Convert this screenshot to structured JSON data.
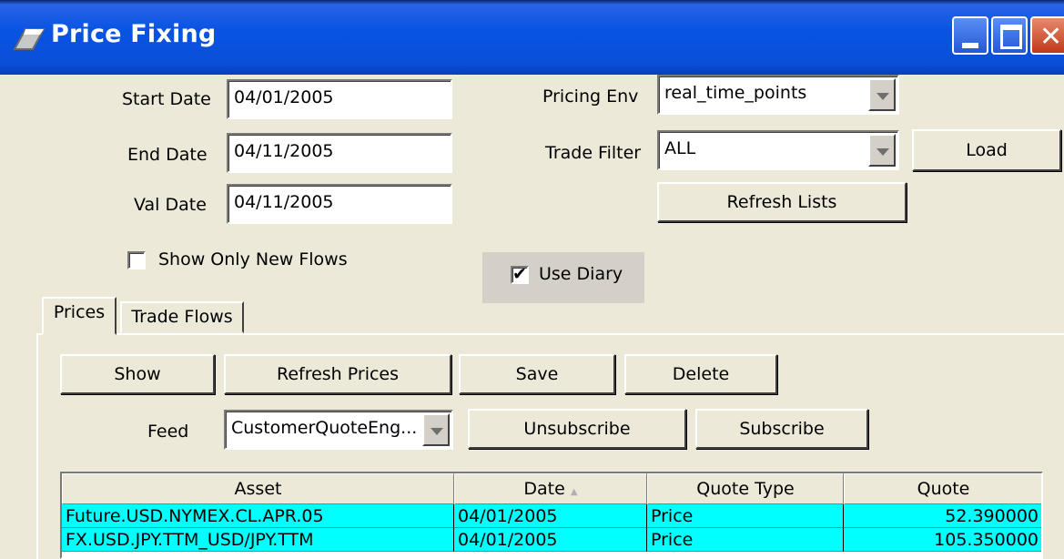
{
  "window": {
    "title": "Price Fixing",
    "controls": [
      "minimize",
      "maximize",
      "close"
    ],
    "titlebar_color": "#0a4fd8"
  },
  "form": {
    "start_date_label": "Start Date",
    "start_date": "04/01/2005",
    "end_date_label": "End Date",
    "end_date": "04/11/2005",
    "val_date_label": "Val Date",
    "val_date": "04/11/2005",
    "pricing_env_label": "Pricing Env",
    "pricing_env": "real_time_points",
    "trade_filter_label": "Trade Filter",
    "trade_filter": "ALL",
    "load_label": "Load",
    "refresh_lists_label": "Refresh Lists",
    "show_only_new_flows_label": "Show Only New Flows",
    "show_only_new_flows_checked": false,
    "use_diary_label": "Use Diary",
    "use_diary_checked": true
  },
  "tabs": [
    {
      "label": "Prices",
      "active": true
    },
    {
      "label": "Trade Flows",
      "active": false
    }
  ],
  "prices": {
    "show_label": "Show",
    "refresh_prices_label": "Refresh Prices",
    "save_label": "Save",
    "delete_label": "Delete",
    "feed_label": "Feed",
    "feed_value": "CustomerQuoteEng...",
    "unsubscribe_label": "Unsubscribe",
    "subscribe_label": "Subscribe"
  },
  "table": {
    "columns": [
      "Asset",
      "Date",
      "Quote Type",
      "Quote"
    ],
    "sort_column": "Date",
    "sort_icon": "sort-ascending-icon",
    "rows": [
      [
        "Future.USD.NYMEX.CL.APR.05",
        "04/01/2005",
        "Price",
        "52.390000"
      ],
      [
        "FX.USD.JPY.TTM_USD/JPY.TTM",
        "04/01/2005",
        "Price",
        "105.350000"
      ]
    ],
    "row_highlight_color": "#00ffff"
  }
}
